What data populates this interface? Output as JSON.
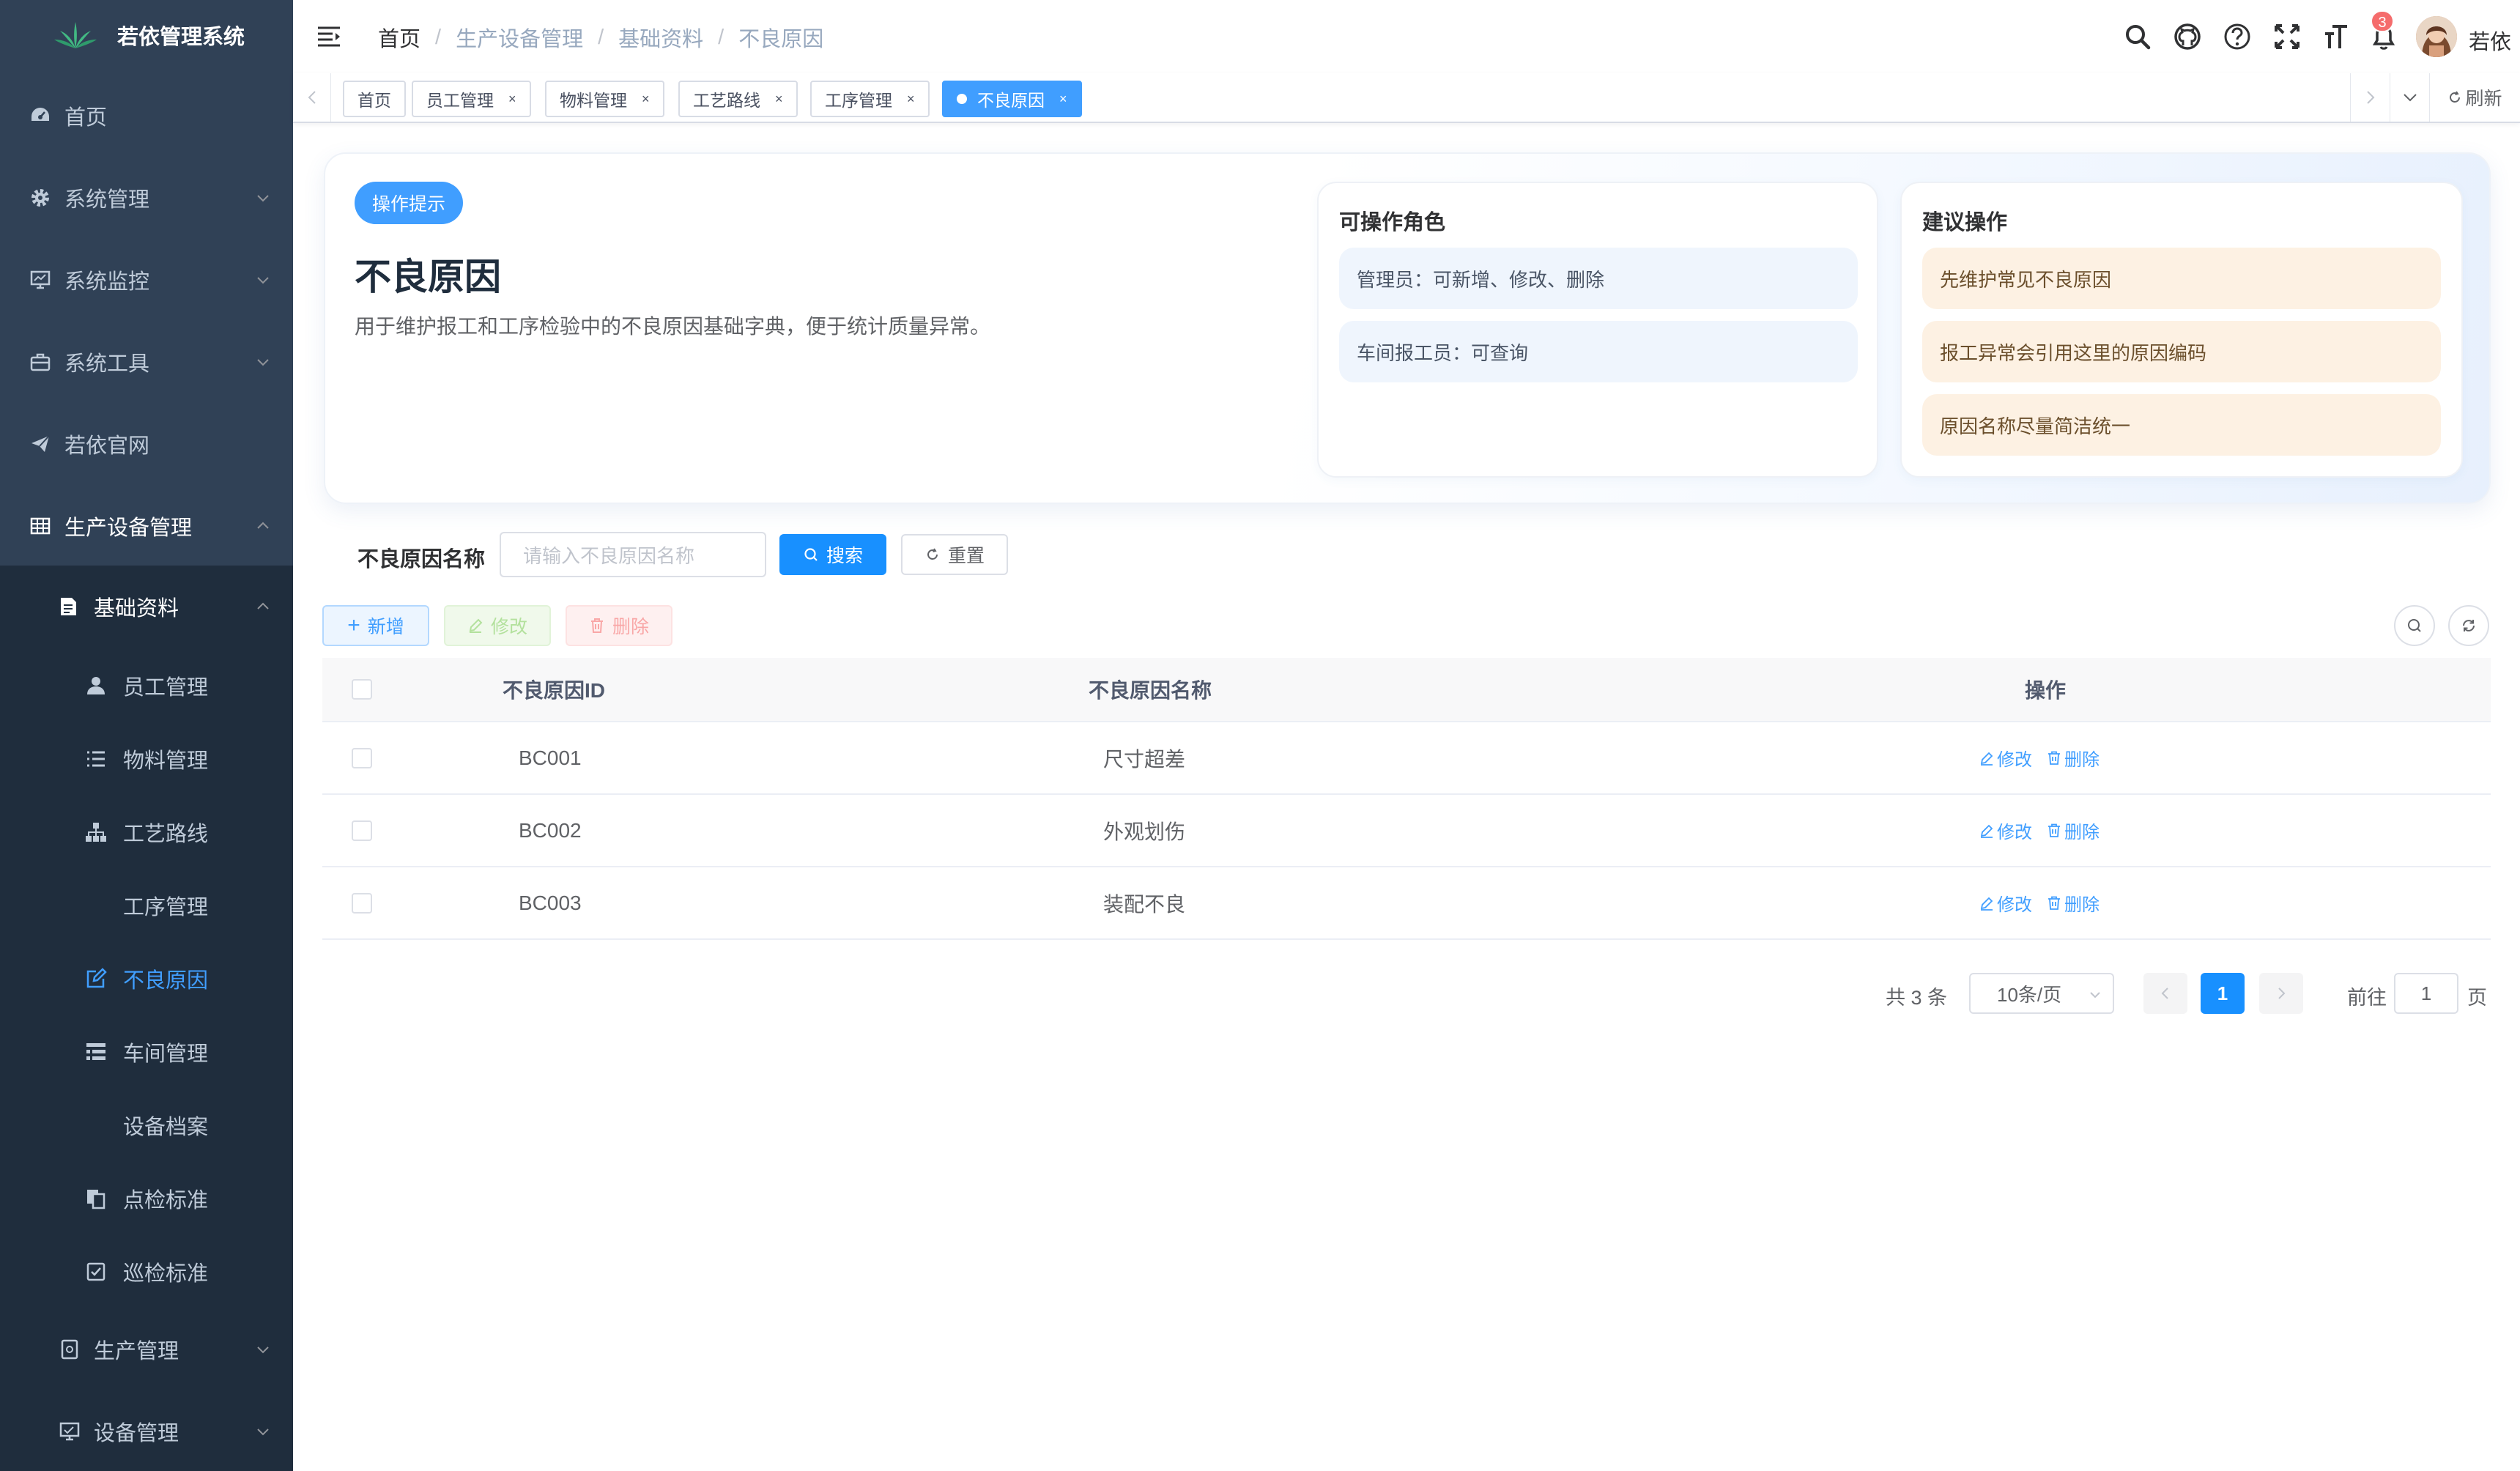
{
  "app": {
    "title": "若依管理系统"
  },
  "sidebar": {
    "items": [
      {
        "label": "首页",
        "icon": "dashboard-icon"
      },
      {
        "label": "系统管理",
        "icon": "gear-icon"
      },
      {
        "label": "系统监控",
        "icon": "monitor-icon"
      },
      {
        "label": "系统工具",
        "icon": "toolbox-icon"
      },
      {
        "label": "若依官网",
        "icon": "paper-plane-icon"
      },
      {
        "label": "生产设备管理",
        "icon": "table-icon"
      }
    ],
    "group": {
      "label": "基础资料",
      "icon": "document-icon"
    },
    "sub_items": [
      {
        "label": "员工管理",
        "icon": "user-icon"
      },
      {
        "label": "物料管理",
        "icon": "list-icon"
      },
      {
        "label": "工艺路线",
        "icon": "tree-icon"
      },
      {
        "label": "工序管理",
        "icon": ""
      },
      {
        "label": "不良原因",
        "icon": "edit-icon"
      },
      {
        "label": "车间管理",
        "icon": "tree-table-icon"
      },
      {
        "label": "设备档案",
        "icon": ""
      },
      {
        "label": "点检标准",
        "icon": "copy-icon"
      },
      {
        "label": "巡检标准",
        "icon": "checkbox-icon"
      }
    ],
    "bottom_items": [
      {
        "label": "生产管理",
        "icon": "production-icon"
      },
      {
        "label": "设备管理",
        "icon": "equipment-icon"
      }
    ]
  },
  "breadcrumb": [
    "首页",
    "生产设备管理",
    "基础资料",
    "不良原因"
  ],
  "navbar": {
    "notification_count": "3",
    "user_name": "若依"
  },
  "tags": [
    "首页",
    "员工管理",
    "物料管理",
    "工艺路线",
    "工序管理",
    "不良原因"
  ],
  "tags_refresh_label": "刷新",
  "hint": {
    "pill": "操作提示",
    "title": "不良原因",
    "description": "用于维护报工和工序检验中的不良原因基础字典，便于统计质量异常。",
    "roles_title": "可操作角色",
    "roles": [
      "管理员：可新增、修改、删除",
      "车间报工员：可查询"
    ],
    "suggest_title": "建议操作",
    "suggestions": [
      "先维护常见不良原因",
      "报工异常会引用这里的原因编码",
      "原因名称尽量简洁统一"
    ]
  },
  "search": {
    "label": "不良原因名称",
    "placeholder": "请输入不良原因名称",
    "search_button": "搜索",
    "reset_button": "重置"
  },
  "toolbar": {
    "add": "新增",
    "edit": "修改",
    "delete": "删除"
  },
  "table": {
    "columns": [
      "不良原因ID",
      "不良原因名称",
      "操作"
    ],
    "rows": [
      {
        "id": "BC001",
        "name": "尺寸超差"
      },
      {
        "id": "BC002",
        "name": "外观划伤"
      },
      {
        "id": "BC003",
        "name": "装配不良"
      }
    ],
    "edit_label": "修改",
    "delete_label": "删除"
  },
  "pagination": {
    "total": "共 3 条",
    "page_size": "10条/页",
    "current_page": "1",
    "goto_prefix": "前往",
    "goto_value": "1",
    "goto_suffix": "页"
  },
  "colors": {
    "sidebar_bg": "#304156",
    "submenu_bg": "#1f2d3d",
    "accent": "#409eff",
    "primary_button": "#1890ff",
    "danger": "#f56c6c"
  }
}
